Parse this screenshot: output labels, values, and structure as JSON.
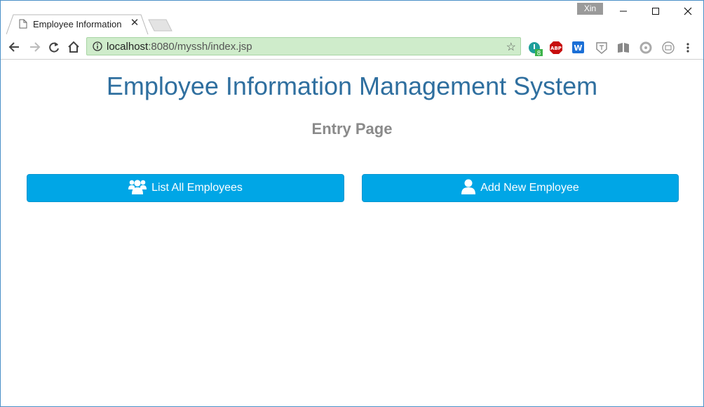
{
  "browser": {
    "tab_title": "Employee Information",
    "profile_name": "Xin",
    "url_host": "localhost",
    "url_path": ":8080/myssh/index.jsp",
    "extensions": [
      "extension-8-badge-icon",
      "adblock-plus-icon",
      "word-icon",
      "translate-icon",
      "reader-icon",
      "circle-icon",
      "screenshot-icon"
    ],
    "extension_badge_count": "8",
    "abp_label": "ABP",
    "word_label": "W",
    "address_bar_color": "#cfeccb"
  },
  "page": {
    "title": "Employee Information Management System",
    "subtitle": "Entry Page",
    "buttons": {
      "list_all": "List All Employees",
      "add_new": "Add New Employee"
    },
    "button_color": "#00a6e6",
    "title_color": "#2f6f9f"
  }
}
